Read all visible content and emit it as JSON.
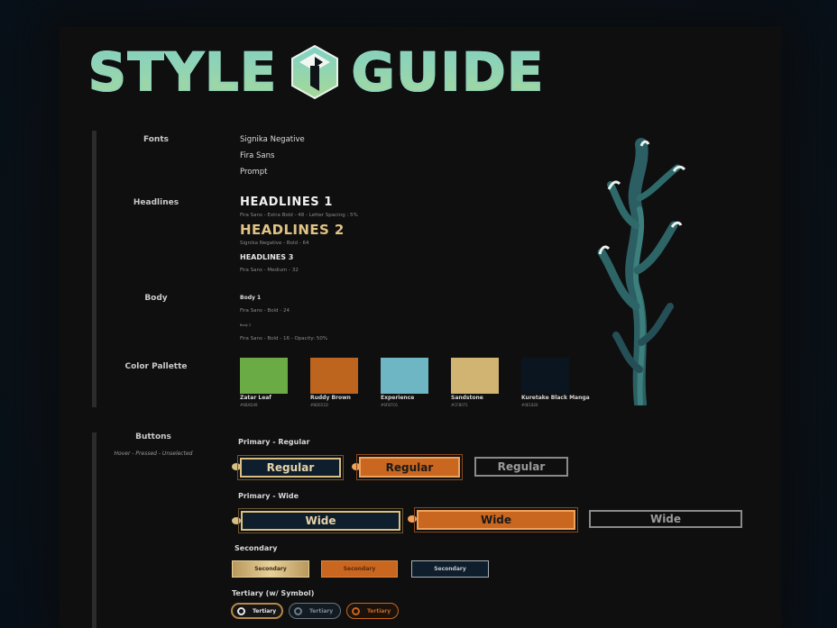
{
  "header": {
    "title_left": "STYLE",
    "title_right": "GUIDE",
    "logo_icon": "hexagon-logo-icon"
  },
  "sections": {
    "fonts": {
      "label": "Fonts",
      "items": [
        "Signika Negative",
        "Fira Sans",
        "Prompt"
      ]
    },
    "headlines": {
      "label": "Headlines",
      "h1": {
        "text": "HEADLINES 1",
        "spec": "Fira Sans - Extra Bold - 48 - Letter Spacing : 5%"
      },
      "h2": {
        "text": "HEADLINES 2",
        "spec": "Signika Negative - Bold - 64"
      },
      "h3": {
        "text": "HEADLINES 3",
        "spec": "Fira Sans - Medium - 32"
      }
    },
    "body": {
      "label": "Body",
      "b1": {
        "text": "Body 1",
        "spec": "Fira Sans - Bold - 24"
      },
      "b2": {
        "text": "Body 2",
        "spec": "Fira Sans - Bold - 16 - Opacity: 50%"
      }
    },
    "palette": {
      "label": "Color Pallette",
      "colors": [
        {
          "name": "Zatar Leaf",
          "hex": "#6BAD49",
          "color": "#6aab45"
        },
        {
          "name": "Ruddy Brown",
          "hex": "#BD651D",
          "color": "#bd641e"
        },
        {
          "name": "Experience",
          "hex": "#6FB7C6",
          "color": "#6fb6c4"
        },
        {
          "name": "Sandstone",
          "hex": "#CFB071",
          "color": "#d2b472"
        },
        {
          "name": "Kuretake Black Manga",
          "hex": "#0E1826",
          "color": "#0b1520"
        }
      ]
    },
    "buttons": {
      "label": "Buttons",
      "states": "Hover - Pressed - Unselected",
      "primary_regular": {
        "title": "Primary - Regular",
        "label": "Regular"
      },
      "primary_wide": {
        "title": "Primary - Wide",
        "label": "Wide"
      },
      "secondary": {
        "title": "Secondary",
        "label": "Secondary"
      },
      "tertiary": {
        "title": "Tertiary (w/ Symbol)",
        "label": "Tertiary"
      }
    }
  },
  "illustration": {
    "icon": "seaweed-illustration-icon"
  }
}
